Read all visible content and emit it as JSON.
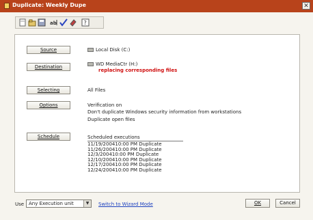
{
  "window": {
    "title": "Duplicate: Weekly Dupe",
    "close_glyph": "✕"
  },
  "toolbar": {
    "icons": [
      "new-icon",
      "open-icon",
      "save-icon",
      "rename-icon",
      "check-icon",
      "eraser-icon",
      "help-icon"
    ]
  },
  "rows": {
    "source": {
      "button": "Source",
      "value": "Local Disk (C:)"
    },
    "destination": {
      "button": "Destination",
      "value": "WD MediaCtr (H:)",
      "note": "replacing corresponding files"
    },
    "selecting": {
      "button": "Selecting",
      "value": "All Files"
    },
    "options": {
      "button": "Options",
      "lines": [
        "Verification on",
        "Don't duplicate Windows security information from workstations",
        "Duplicate open files"
      ]
    },
    "schedule": {
      "button": "Schedule",
      "header": "Scheduled executions",
      "entries": [
        {
          "date": "11/19/2004",
          "time": "10:00 PM",
          "action": "Duplicate"
        },
        {
          "date": "11/26/2004",
          "time": "10:00 PM",
          "action": "Duplicate"
        },
        {
          "date": "12/3/2004",
          "time": "10:00 PM",
          "action": "Duplicate"
        },
        {
          "date": "12/10/2004",
          "time": "10:00 PM",
          "action": "Duplicate"
        },
        {
          "date": "12/17/2004",
          "time": "10:00 PM",
          "action": "Duplicate"
        },
        {
          "date": "12/24/2004",
          "time": "10:00 PM",
          "action": "Duplicate"
        }
      ]
    }
  },
  "footer": {
    "use_label": "Use",
    "execution_unit": "Any Execution unit",
    "wizard_link": "Switch to Wizard Mode",
    "ok_label": "OK",
    "cancel_label": "Cancel"
  },
  "colors": {
    "titlebar": "#b8431b",
    "link": "#1a3fbf",
    "warning": "#d01010"
  }
}
